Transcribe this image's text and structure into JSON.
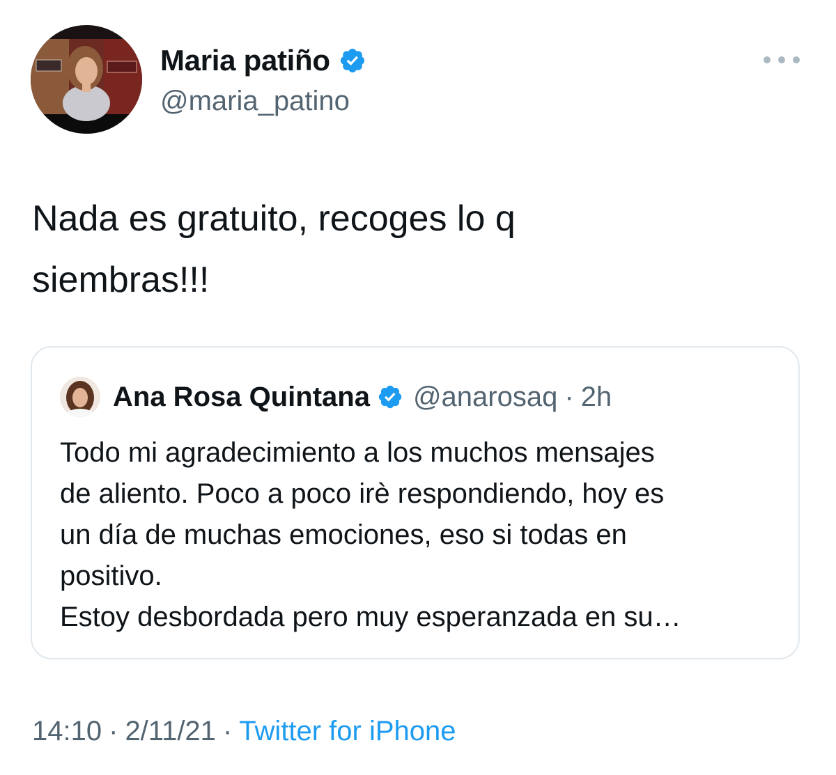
{
  "author": {
    "name": "Maria patiño",
    "handle": "@maria_patino",
    "avatar_icon": "profile-photo",
    "verified": true
  },
  "tweet": {
    "text": "Nada es gratuito, recoges lo q\nsiembras!!!"
  },
  "quoted_tweet": {
    "name": "Ana Rosa Quintana",
    "handle": "@anarosaq",
    "separator": "·",
    "time": "2h",
    "verified": true,
    "text": "Todo mi agradecimiento a los muchos mensajes\nde aliento. Poco a poco irè respondiendo, hoy es\nun día de muchas emociones, eso si todas en\npositivo.\nEstoy desbordada pero muy esperanzada en su…"
  },
  "meta": {
    "time": "14:10",
    "separator": "·",
    "date": "2/11/21",
    "source": "Twitter for iPhone"
  },
  "colors": {
    "verified_blue": "#1d9bf0",
    "link_blue": "#1d9bf0",
    "secondary_text": "#536471",
    "border": "#e1e8ed"
  }
}
